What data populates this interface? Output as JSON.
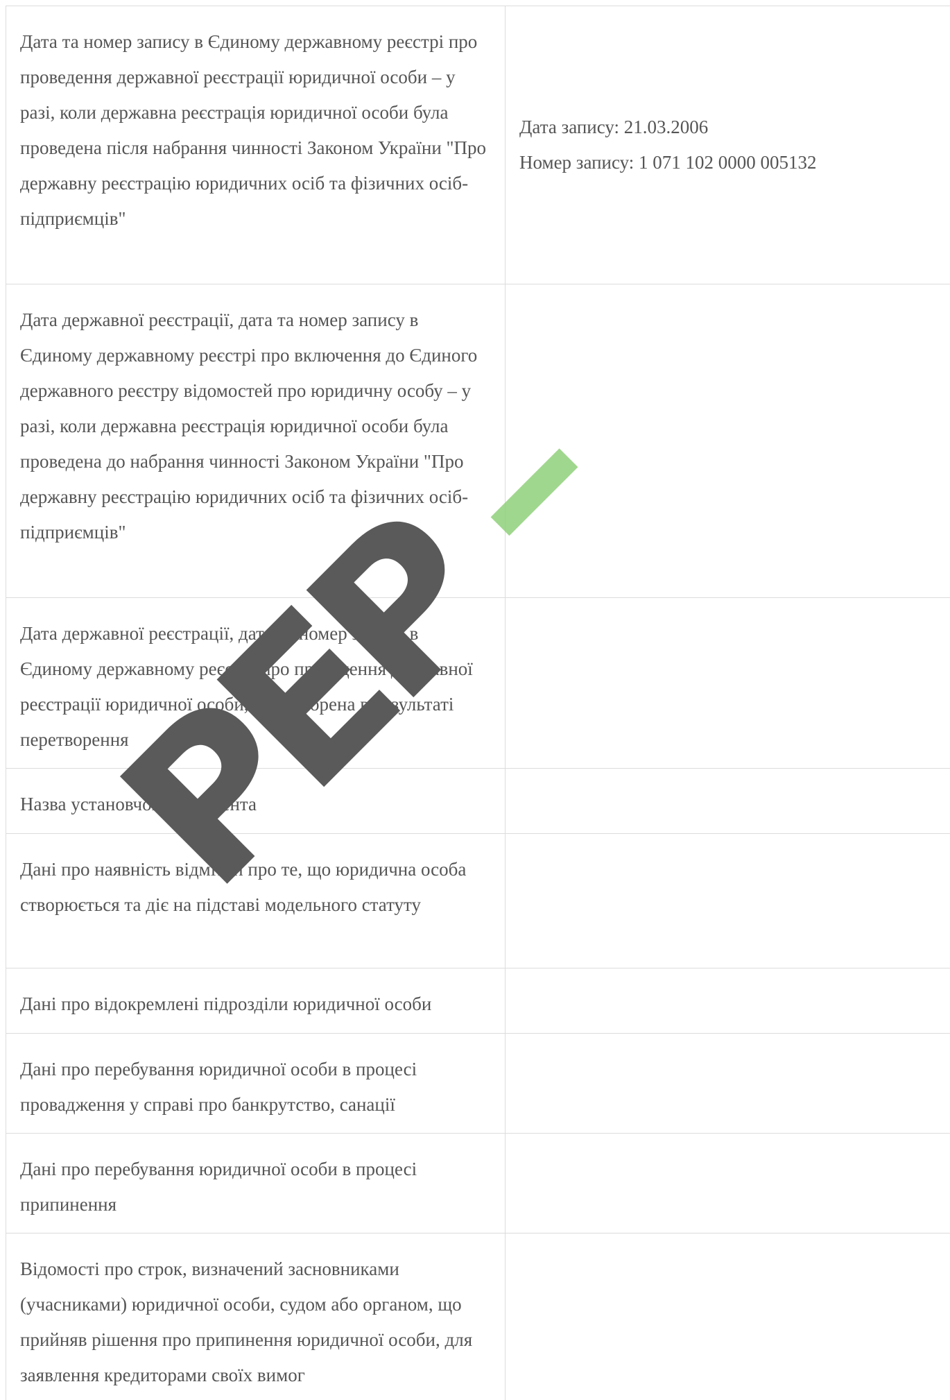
{
  "rows": [
    {
      "label": "Дата та номер запису в Єдиному державному реєстрі про проведення державної реєстрації юридичної особи – у разі, коли державна реєстрація юридичної особи була проведена після набрання чинності Законом України \"Про державну реєстрацію юридичних осіб та фізичних осіб-підприємців\"",
      "value_line1": "Дата запису: 21.03.2006",
      "value_line2": "Номер запису: 1 071 102 0000 005132"
    },
    {
      "label": "Дата державної реєстрації, дата та номер запису в Єдиному державному реєстрі про включення до Єдиного державного реєстру відомостей про юридичну особу – у разі, коли державна реєстрація юридичної особи була проведена до набрання чинності Законом України \"Про державну реєстрацію юридичних осіб та фізичних осіб-підприємців\"",
      "value_line1": "",
      "value_line2": ""
    },
    {
      "label": "Дата державної реєстрації, дата та номер запису в Єдиному державному реєстрі про проведення державної реєстрації юридичної особи, яка утворена в результаті перетворення",
      "value_line1": "",
      "value_line2": ""
    },
    {
      "label": "Назва установчого документа",
      "value_line1": "",
      "value_line2": ""
    },
    {
      "label": "Дані про наявність відмітки про те, що юридична особа створюється та діє на підставі модельного статуту",
      "value_line1": "",
      "value_line2": ""
    },
    {
      "label": "Дані про відокремлені підрозділи юридичної особи",
      "value_line1": "",
      "value_line2": ""
    },
    {
      "label": "Дані про перебування юридичної особи в процесі провадження у справі про банкрутство, санації",
      "value_line1": "",
      "value_line2": ""
    },
    {
      "label": "Дані про перебування юридичної особи в процесі припинення",
      "value_line1": "",
      "value_line2": ""
    },
    {
      "label": "Відомості про строк, визначений засновниками (учасниками) юридичної особи, судом або органом, що прийняв рішення про припинення юридичної особи, для заявлення кредиторами своїх вимог",
      "value_line1": "",
      "value_line2": ""
    }
  ],
  "watermark": {
    "letters": [
      "Р",
      "Е",
      "Р"
    ],
    "letter_color": "#5a5a5a",
    "accent_color": "#8fd07a"
  }
}
